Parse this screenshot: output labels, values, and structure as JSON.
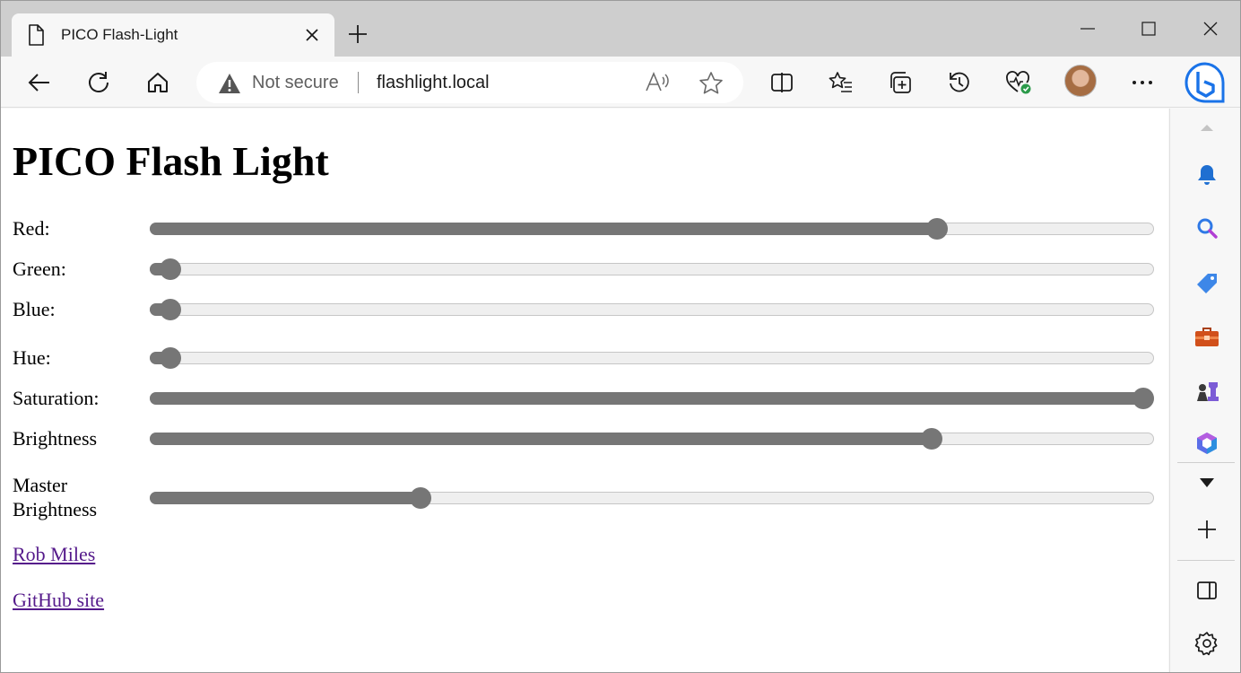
{
  "browser": {
    "tab": {
      "title": "PICO Flash-Light"
    },
    "address": {
      "security_label": "Not secure",
      "url": "flashlight.local"
    }
  },
  "page": {
    "title": "PICO Flash Light",
    "sliders": [
      {
        "label": "Red:",
        "value": 0.79
      },
      {
        "label": "Green:",
        "value": 0.01
      },
      {
        "label": "Blue:",
        "value": 0.01
      },
      {
        "label": "Hue:",
        "value": 0.01
      },
      {
        "label": "Saturation:",
        "value": 1.0
      },
      {
        "label": "Brightness",
        "value": 0.785
      },
      {
        "label": "Master Brightness",
        "value": 0.265
      }
    ],
    "links": [
      {
        "text": "Rob Miles"
      },
      {
        "text": "GitHub site"
      }
    ]
  },
  "colors": {
    "slider_fill": "#767676",
    "link": "#551a8b",
    "sidebar_bell": "#1f6fd1",
    "sidebar_search": "#2f79e6",
    "sidebar_tag": "#3d87e8",
    "sidebar_toolbox": "#d1501b",
    "sidebar_games": "#7c5cd6"
  },
  "sidebar_icons": [
    "bell-icon",
    "search-icon",
    "shopping-tag-icon",
    "toolbox-icon",
    "games-icon",
    "office-icon",
    "expand-icon",
    "add-icon",
    "split-panel-icon",
    "settings-icon"
  ]
}
